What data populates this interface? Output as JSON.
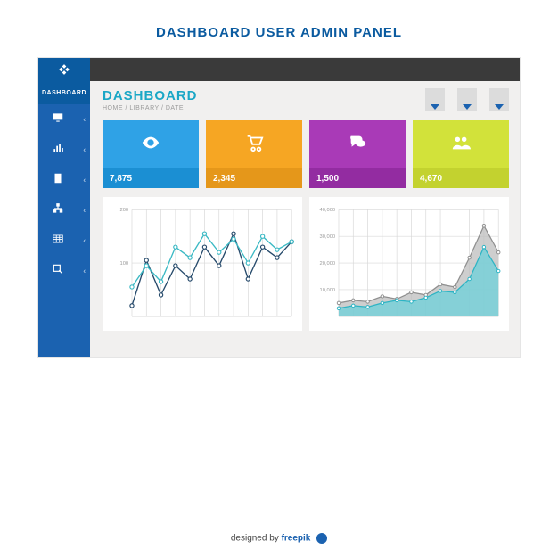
{
  "page_title": "DASHBOARD USER ADMIN PANEL",
  "sidebar": {
    "active_label": "DASHBOARD",
    "items": [
      {
        "icon": "monitor"
      },
      {
        "icon": "bars"
      },
      {
        "icon": "page"
      },
      {
        "icon": "sitemap"
      },
      {
        "icon": "grid"
      },
      {
        "icon": "search"
      }
    ]
  },
  "header": {
    "title": "DASHBOARD",
    "breadcrumb": "HOME / LIBRARY / DATE"
  },
  "cards": [
    {
      "icon": "eye",
      "value": "7,875",
      "color": "blue"
    },
    {
      "icon": "cart",
      "value": "2,345",
      "color": "orange"
    },
    {
      "icon": "chat",
      "value": "1,500",
      "color": "purple"
    },
    {
      "icon": "users",
      "value": "4,670",
      "color": "lime"
    }
  ],
  "chart_data": [
    {
      "type": "line",
      "title": "",
      "xlabel": "",
      "ylabel": "",
      "ylim": [
        0,
        200
      ],
      "yticks": [
        200,
        100
      ],
      "x": [
        0,
        1,
        2,
        3,
        4,
        5,
        6,
        7,
        8,
        9,
        10,
        11
      ],
      "series": [
        {
          "name": "dark",
          "color": "#264a6b",
          "values": [
            20,
            105,
            40,
            95,
            70,
            130,
            95,
            155,
            70,
            130,
            110,
            140
          ]
        },
        {
          "name": "teal",
          "color": "#3bb9c4",
          "values": [
            55,
            95,
            65,
            130,
            110,
            155,
            120,
            145,
            100,
            150,
            125,
            140
          ]
        }
      ]
    },
    {
      "type": "area",
      "title": "",
      "xlabel": "",
      "ylabel": "",
      "ylim": [
        0,
        40000
      ],
      "yticks": [
        40000,
        30000,
        20000,
        10000
      ],
      "x": [
        0,
        1,
        2,
        3,
        4,
        5,
        6,
        7,
        8,
        9,
        10,
        11
      ],
      "series": [
        {
          "name": "grey",
          "stroke": "#8f8f8f",
          "fill": "#bdbdbd",
          "values": [
            5000,
            6000,
            5500,
            7500,
            6500,
            9000,
            8000,
            12000,
            11000,
            22000,
            34000,
            24000
          ]
        },
        {
          "name": "teal",
          "stroke": "#2db4c4",
          "fill": "#6cd0da",
          "values": [
            3000,
            4000,
            3500,
            5000,
            6000,
            5500,
            7000,
            9500,
            9000,
            14000,
            26000,
            17000
          ]
        }
      ]
    }
  ],
  "credit": {
    "prefix": "designed by ",
    "brand": "freepik"
  }
}
